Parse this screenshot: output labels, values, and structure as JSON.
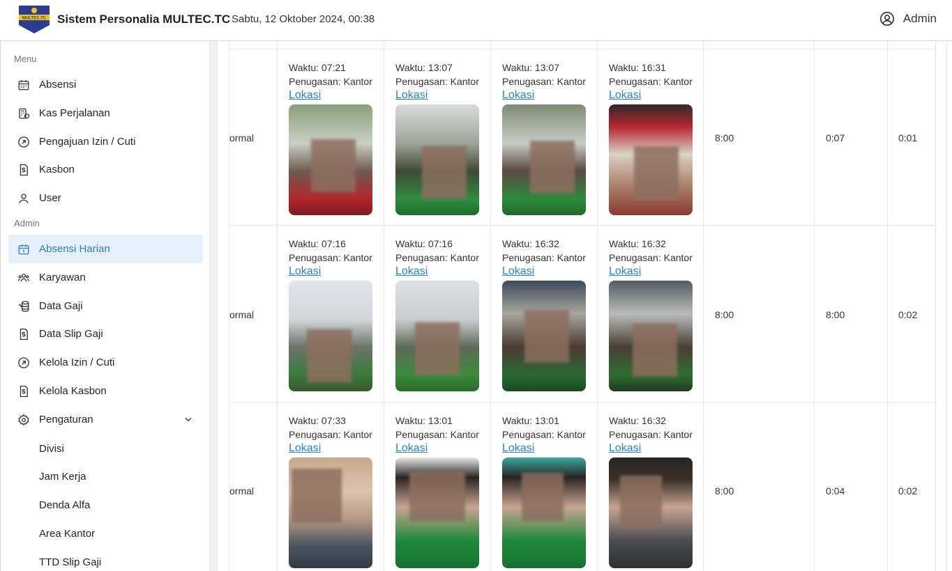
{
  "header": {
    "app_title": "Sistem Personalia MULTEC.TC",
    "datetime": "Sabtu, 12 Oktober 2024, 00:38",
    "user_name": "Admin",
    "logo_text": "MULTEC.TC"
  },
  "sidebar": {
    "menu_label": "Menu",
    "admin_label": "Admin",
    "menu_items": [
      {
        "label": "Absensi",
        "icon": "calendar-icon"
      },
      {
        "label": "Kas Perjalanan",
        "icon": "wallet-icon"
      },
      {
        "label": "Pengajuan Izin / Cuti",
        "icon": "arrow-circle-icon"
      },
      {
        "label": "Kasbon",
        "icon": "dollar-file-icon"
      },
      {
        "label": "User",
        "icon": "user-icon"
      }
    ],
    "admin_items": [
      {
        "label": "Absensi Harian",
        "icon": "calendar-day-icon",
        "active": true
      },
      {
        "label": "Karyawan",
        "icon": "users-icon"
      },
      {
        "label": "Data Gaji",
        "icon": "coins-icon"
      },
      {
        "label": "Data Slip Gaji",
        "icon": "dollar-file-icon"
      },
      {
        "label": "Kelola Izin / Cuti",
        "icon": "arrow-circle-icon"
      },
      {
        "label": "Kelola Kasbon",
        "icon": "dollar-file-icon"
      },
      {
        "label": "Pengaturan",
        "icon": "gear-icon"
      }
    ],
    "settings_sub": [
      "Divisi",
      "Jam Kerja",
      "Denda Alfa",
      "Area Kantor",
      "TTD Slip Gaji"
    ]
  },
  "table": {
    "rows": [
      {
        "status": "ormal",
        "photos": [
          {
            "time": "Waktu: 07:21",
            "assign": "Penugasan: Kantor",
            "link": "Lokasi"
          },
          {
            "time": "Waktu: 13:07",
            "assign": "Penugasan: Kantor",
            "link": "Lokasi"
          },
          {
            "time": "Waktu: 13:07",
            "assign": "Penugasan: Kantor",
            "link": "Lokasi"
          },
          {
            "time": "Waktu: 16:31",
            "assign": "Penugasan: Kantor",
            "link": "Lokasi"
          }
        ],
        "jam_kerja": "8:00",
        "lembur": "0:07",
        "telat": "0:01"
      },
      {
        "status": "ormal",
        "photos": [
          {
            "time": "Waktu: 07:16",
            "assign": "Penugasan: Kantor",
            "link": "Lokasi"
          },
          {
            "time": "Waktu: 07:16",
            "assign": "Penugasan: Kantor",
            "link": "Lokasi"
          },
          {
            "time": "Waktu: 16:32",
            "assign": "Penugasan: Kantor",
            "link": "Lokasi"
          },
          {
            "time": "Waktu: 16:32",
            "assign": "Penugasan: Kantor",
            "link": "Lokasi"
          }
        ],
        "jam_kerja": "8:00",
        "lembur": "8:00",
        "telat": "0:02"
      },
      {
        "status": "ormal",
        "photos": [
          {
            "time": "Waktu: 07:33",
            "assign": "Penugasan: Kantor",
            "link": "Lokasi"
          },
          {
            "time": "Waktu: 13:01",
            "assign": "Penugasan: Kantor",
            "link": "Lokasi"
          },
          {
            "time": "Waktu: 13:01",
            "assign": "Penugasan: Kantor",
            "link": "Lokasi"
          },
          {
            "time": "Waktu: 16:32",
            "assign": "Penugasan: Kantor",
            "link": "Lokasi"
          }
        ],
        "jam_kerja": "8:00",
        "lembur": "0:04",
        "telat": "0:02"
      }
    ]
  },
  "colors": {
    "accent": "#2a7fc9",
    "active_bg": "#e6f1fb"
  }
}
